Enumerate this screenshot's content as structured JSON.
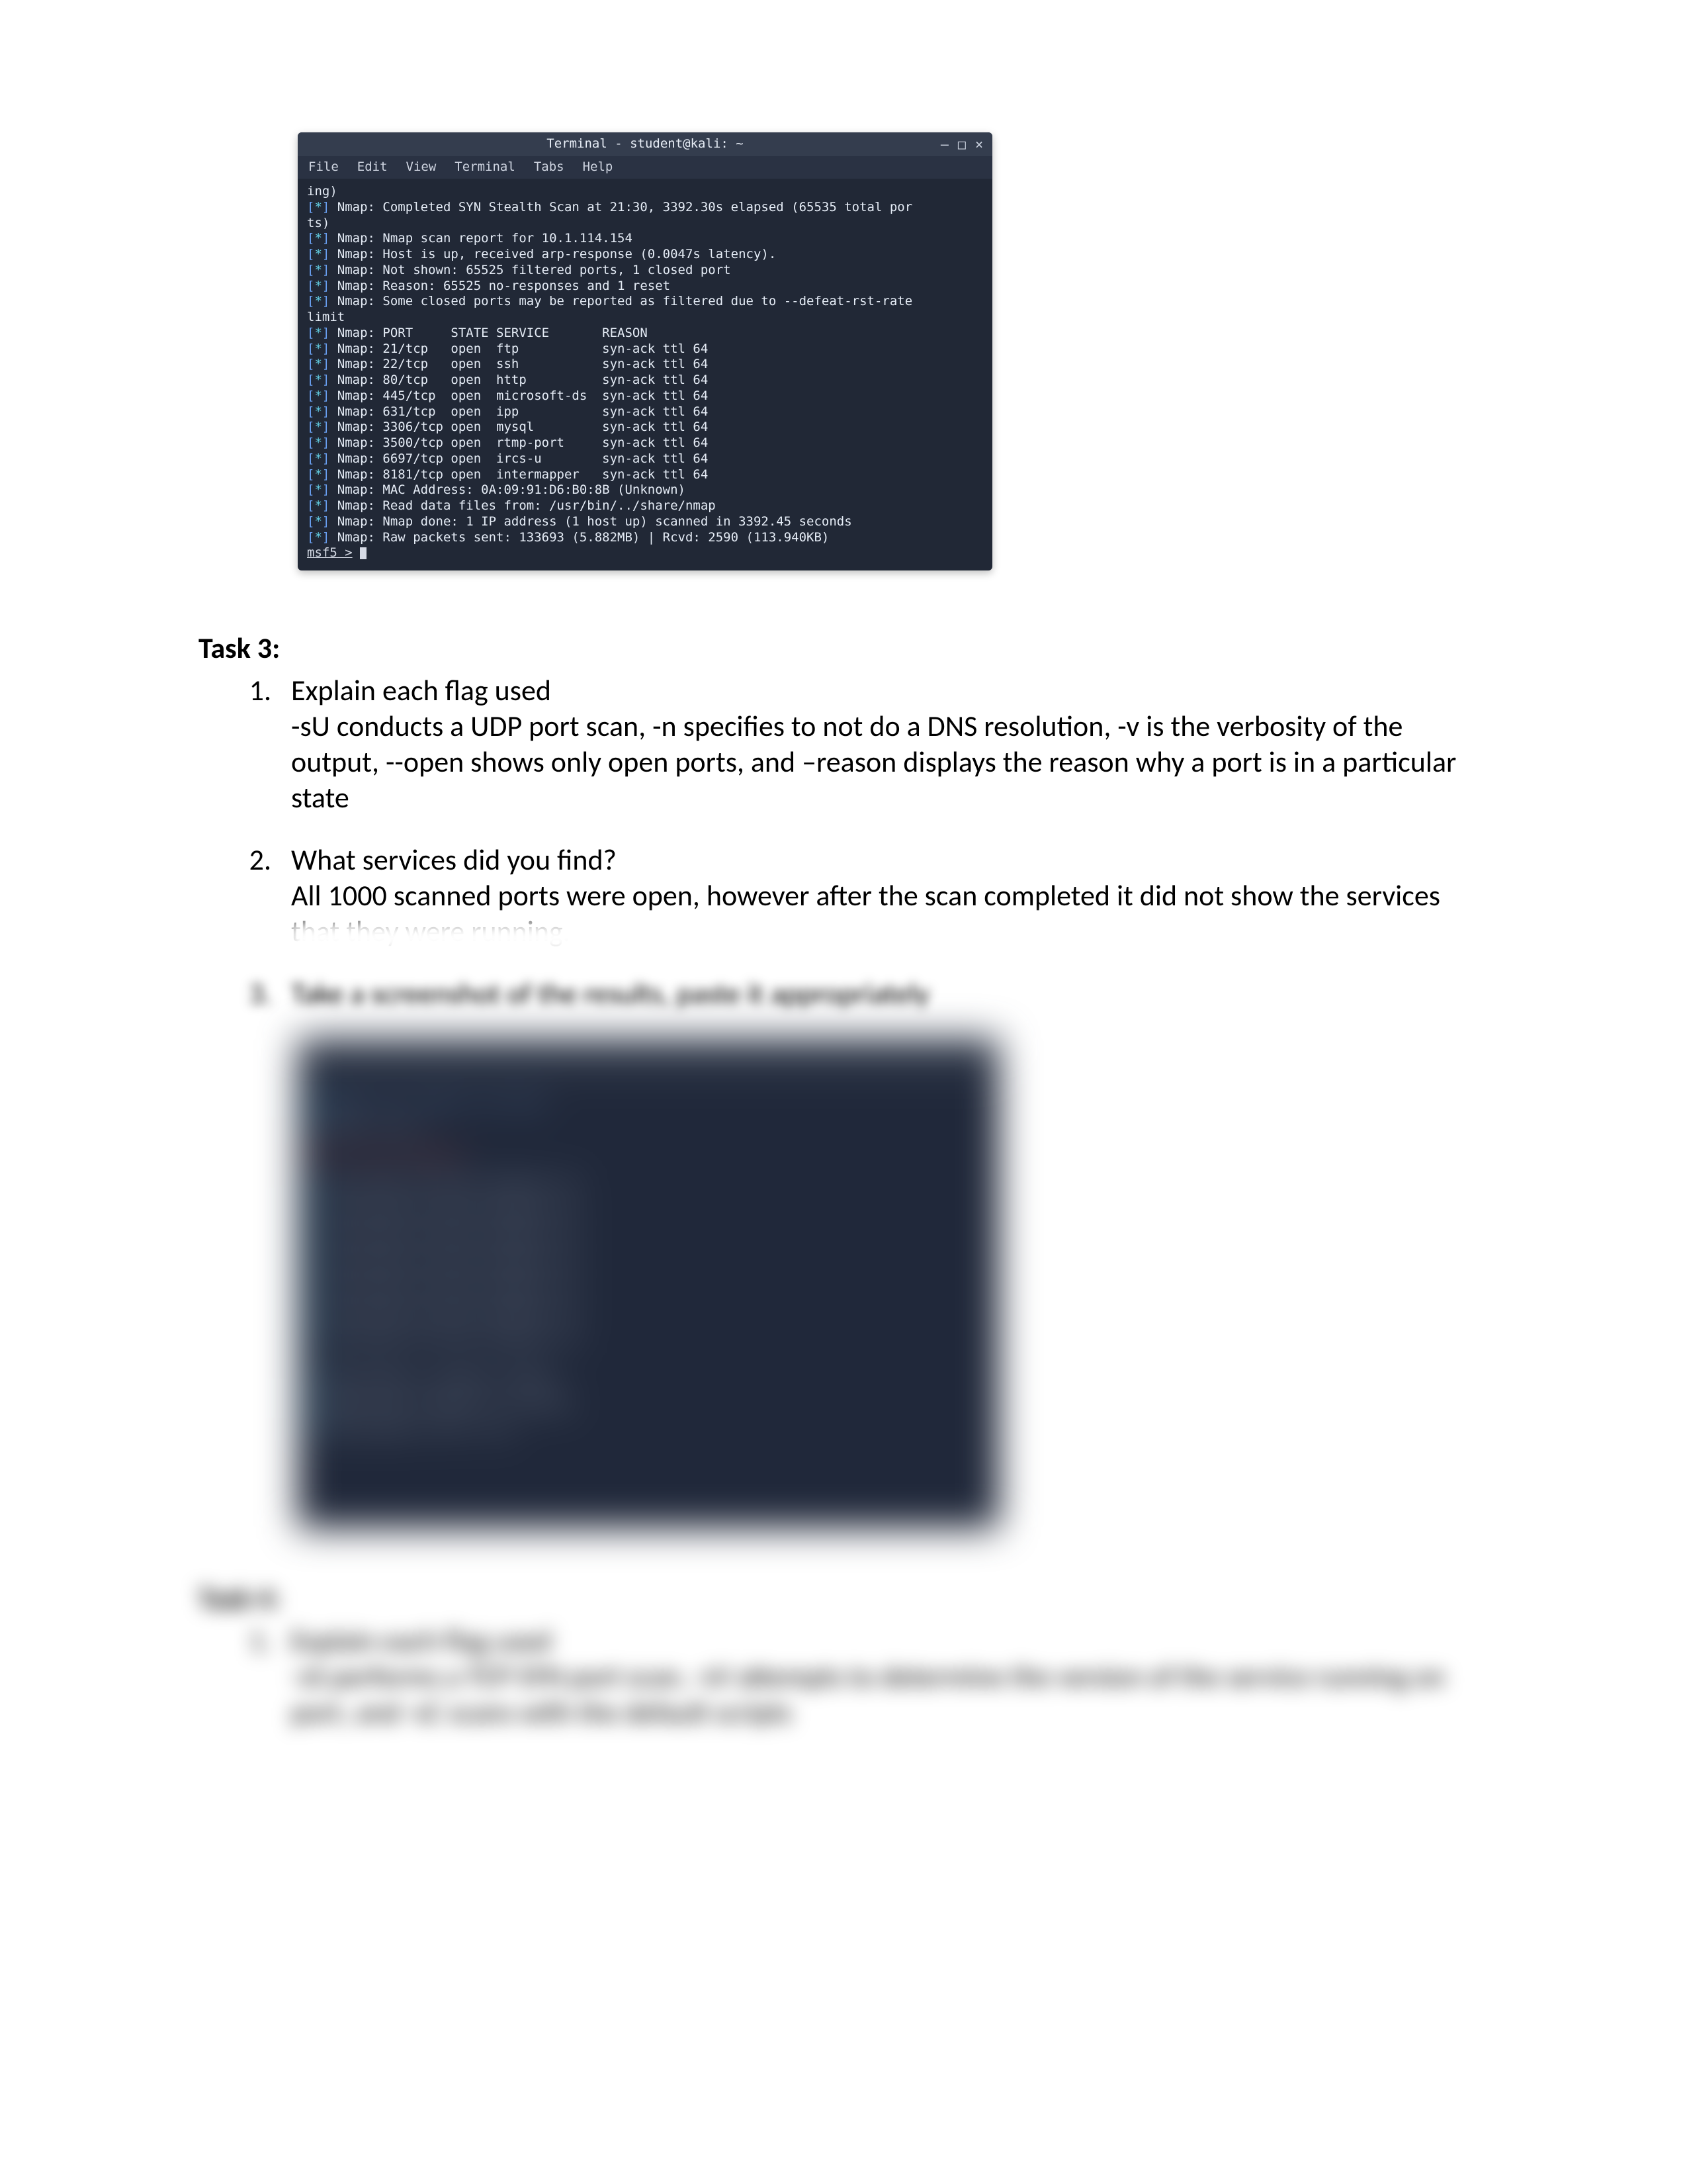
{
  "terminal": {
    "title": "Terminal - student@kali: ~",
    "menu": [
      "File",
      "Edit",
      "View",
      "Terminal",
      "Tabs",
      "Help"
    ],
    "lines": [
      "ing)",
      "[*] Nmap: Completed SYN Stealth Scan at 21:30, 3392.30s elapsed (65535 total por",
      "ts)",
      "[*] Nmap: Nmap scan report for 10.1.114.154",
      "[*] Nmap: Host is up, received arp-response (0.0047s latency).",
      "[*] Nmap: Not shown: 65525 filtered ports, 1 closed port",
      "[*] Nmap: Reason: 65525 no-responses and 1 reset",
      "[*] Nmap: Some closed ports may be reported as filtered due to --defeat-rst-rate",
      "limit",
      "[*] Nmap: PORT     STATE SERVICE       REASON",
      "[*] Nmap: 21/tcp   open  ftp           syn-ack ttl 64",
      "[*] Nmap: 22/tcp   open  ssh           syn-ack ttl 64",
      "[*] Nmap: 80/tcp   open  http          syn-ack ttl 64",
      "[*] Nmap: 445/tcp  open  microsoft-ds  syn-ack ttl 64",
      "[*] Nmap: 631/tcp  open  ipp           syn-ack ttl 64",
      "[*] Nmap: 3306/tcp open  mysql         syn-ack ttl 64",
      "[*] Nmap: 3500/tcp open  rtmp-port     syn-ack ttl 64",
      "[*] Nmap: 6697/tcp open  ircs-u        syn-ack ttl 64",
      "[*] Nmap: 8181/tcp open  intermapper   syn-ack ttl 64",
      "[*] Nmap: MAC Address: 0A:09:91:D6:B0:8B (Unknown)",
      "[*] Nmap: Read data files from: /usr/bin/../share/nmap",
      "[*] Nmap: Nmap done: 1 IP address (1 host up) scanned in 3392.45 seconds",
      "[*] Nmap: Raw packets sent: 133693 (5.882MB) | Rcvd: 2590 (113.940KB)"
    ],
    "prompt": "msf5 > "
  },
  "task3": {
    "heading": "Task 3:",
    "items": [
      {
        "title": "Explain each flag used",
        "body": "-sU conducts a UDP port scan, -n specifies to not do a DNS resolution, -v is the verbosity of the output, --open shows only open ports, and –reason displays the reason why a port is in a particular state"
      },
      {
        "title": "What services did you find?",
        "body": "All 1000 scanned ports were open, however after the scan completed it did not show the services that they were running."
      },
      {
        "title": "Take a screenshot of the results, paste it appropriately",
        "body": ""
      }
    ]
  },
  "task4": {
    "heading": "Task 4:",
    "items": [
      {
        "title": "Explain each flag used",
        "body": "-sS performs a TCP SYN port scan, -sV attempts to determine the version of the service running on port, and -sC scans with the default scripts"
      }
    ]
  },
  "controls": {
    "min": "—",
    "max": "□",
    "close": "×"
  }
}
